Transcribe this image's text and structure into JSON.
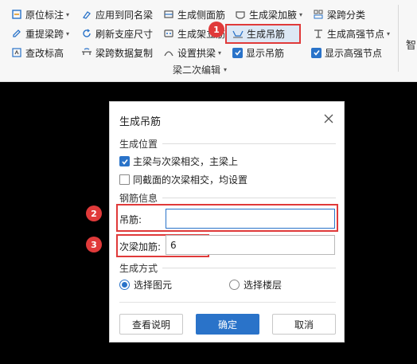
{
  "ribbon": {
    "row1": [
      {
        "label": "原位标注",
        "caret": "▾"
      },
      {
        "label": "应用到同名梁"
      },
      {
        "label": "生成侧面筋"
      },
      {
        "label": "生成梁加腋",
        "caret": "▾"
      },
      {
        "label": "梁跨分类"
      }
    ],
    "row2": [
      {
        "label": "重提梁跨",
        "caret": "▾"
      },
      {
        "label": "刷新支座尺寸"
      },
      {
        "label": "生成架立筋"
      },
      {
        "label": "生成吊筋"
      },
      {
        "label": "生成高强节点",
        "caret": "▾"
      }
    ],
    "row3": [
      {
        "label": "查改标高"
      },
      {
        "label": "梁跨数据复制"
      },
      {
        "label": "设置拱梁",
        "caret": "▾"
      },
      {
        "label": "显示吊筋"
      },
      {
        "label": "显示高强节点"
      }
    ],
    "group_label": "梁二次编辑",
    "group_caret": "▾",
    "right_cut_label": "智"
  },
  "badges": [
    "1",
    "2",
    "3"
  ],
  "dialog": {
    "title": "生成吊筋",
    "section_position": "生成位置",
    "opt_main_beam": "主梁与次梁相交，主梁上",
    "opt_same_section": "同截面的次梁相交，均设置",
    "section_rebar": "钢筋信息",
    "hanger_label": "吊筋:",
    "hanger_value": "",
    "secondary_label": "次梁加筋:",
    "secondary_value": "6",
    "section_method": "生成方式",
    "radio_select_element": "选择图元",
    "radio_select_floor": "选择楼层",
    "btn_help": "查看说明",
    "btn_ok": "确定",
    "btn_cancel": "取消"
  },
  "colors": {
    "accent": "#2a73c9",
    "highlight": "#e03a3a"
  }
}
